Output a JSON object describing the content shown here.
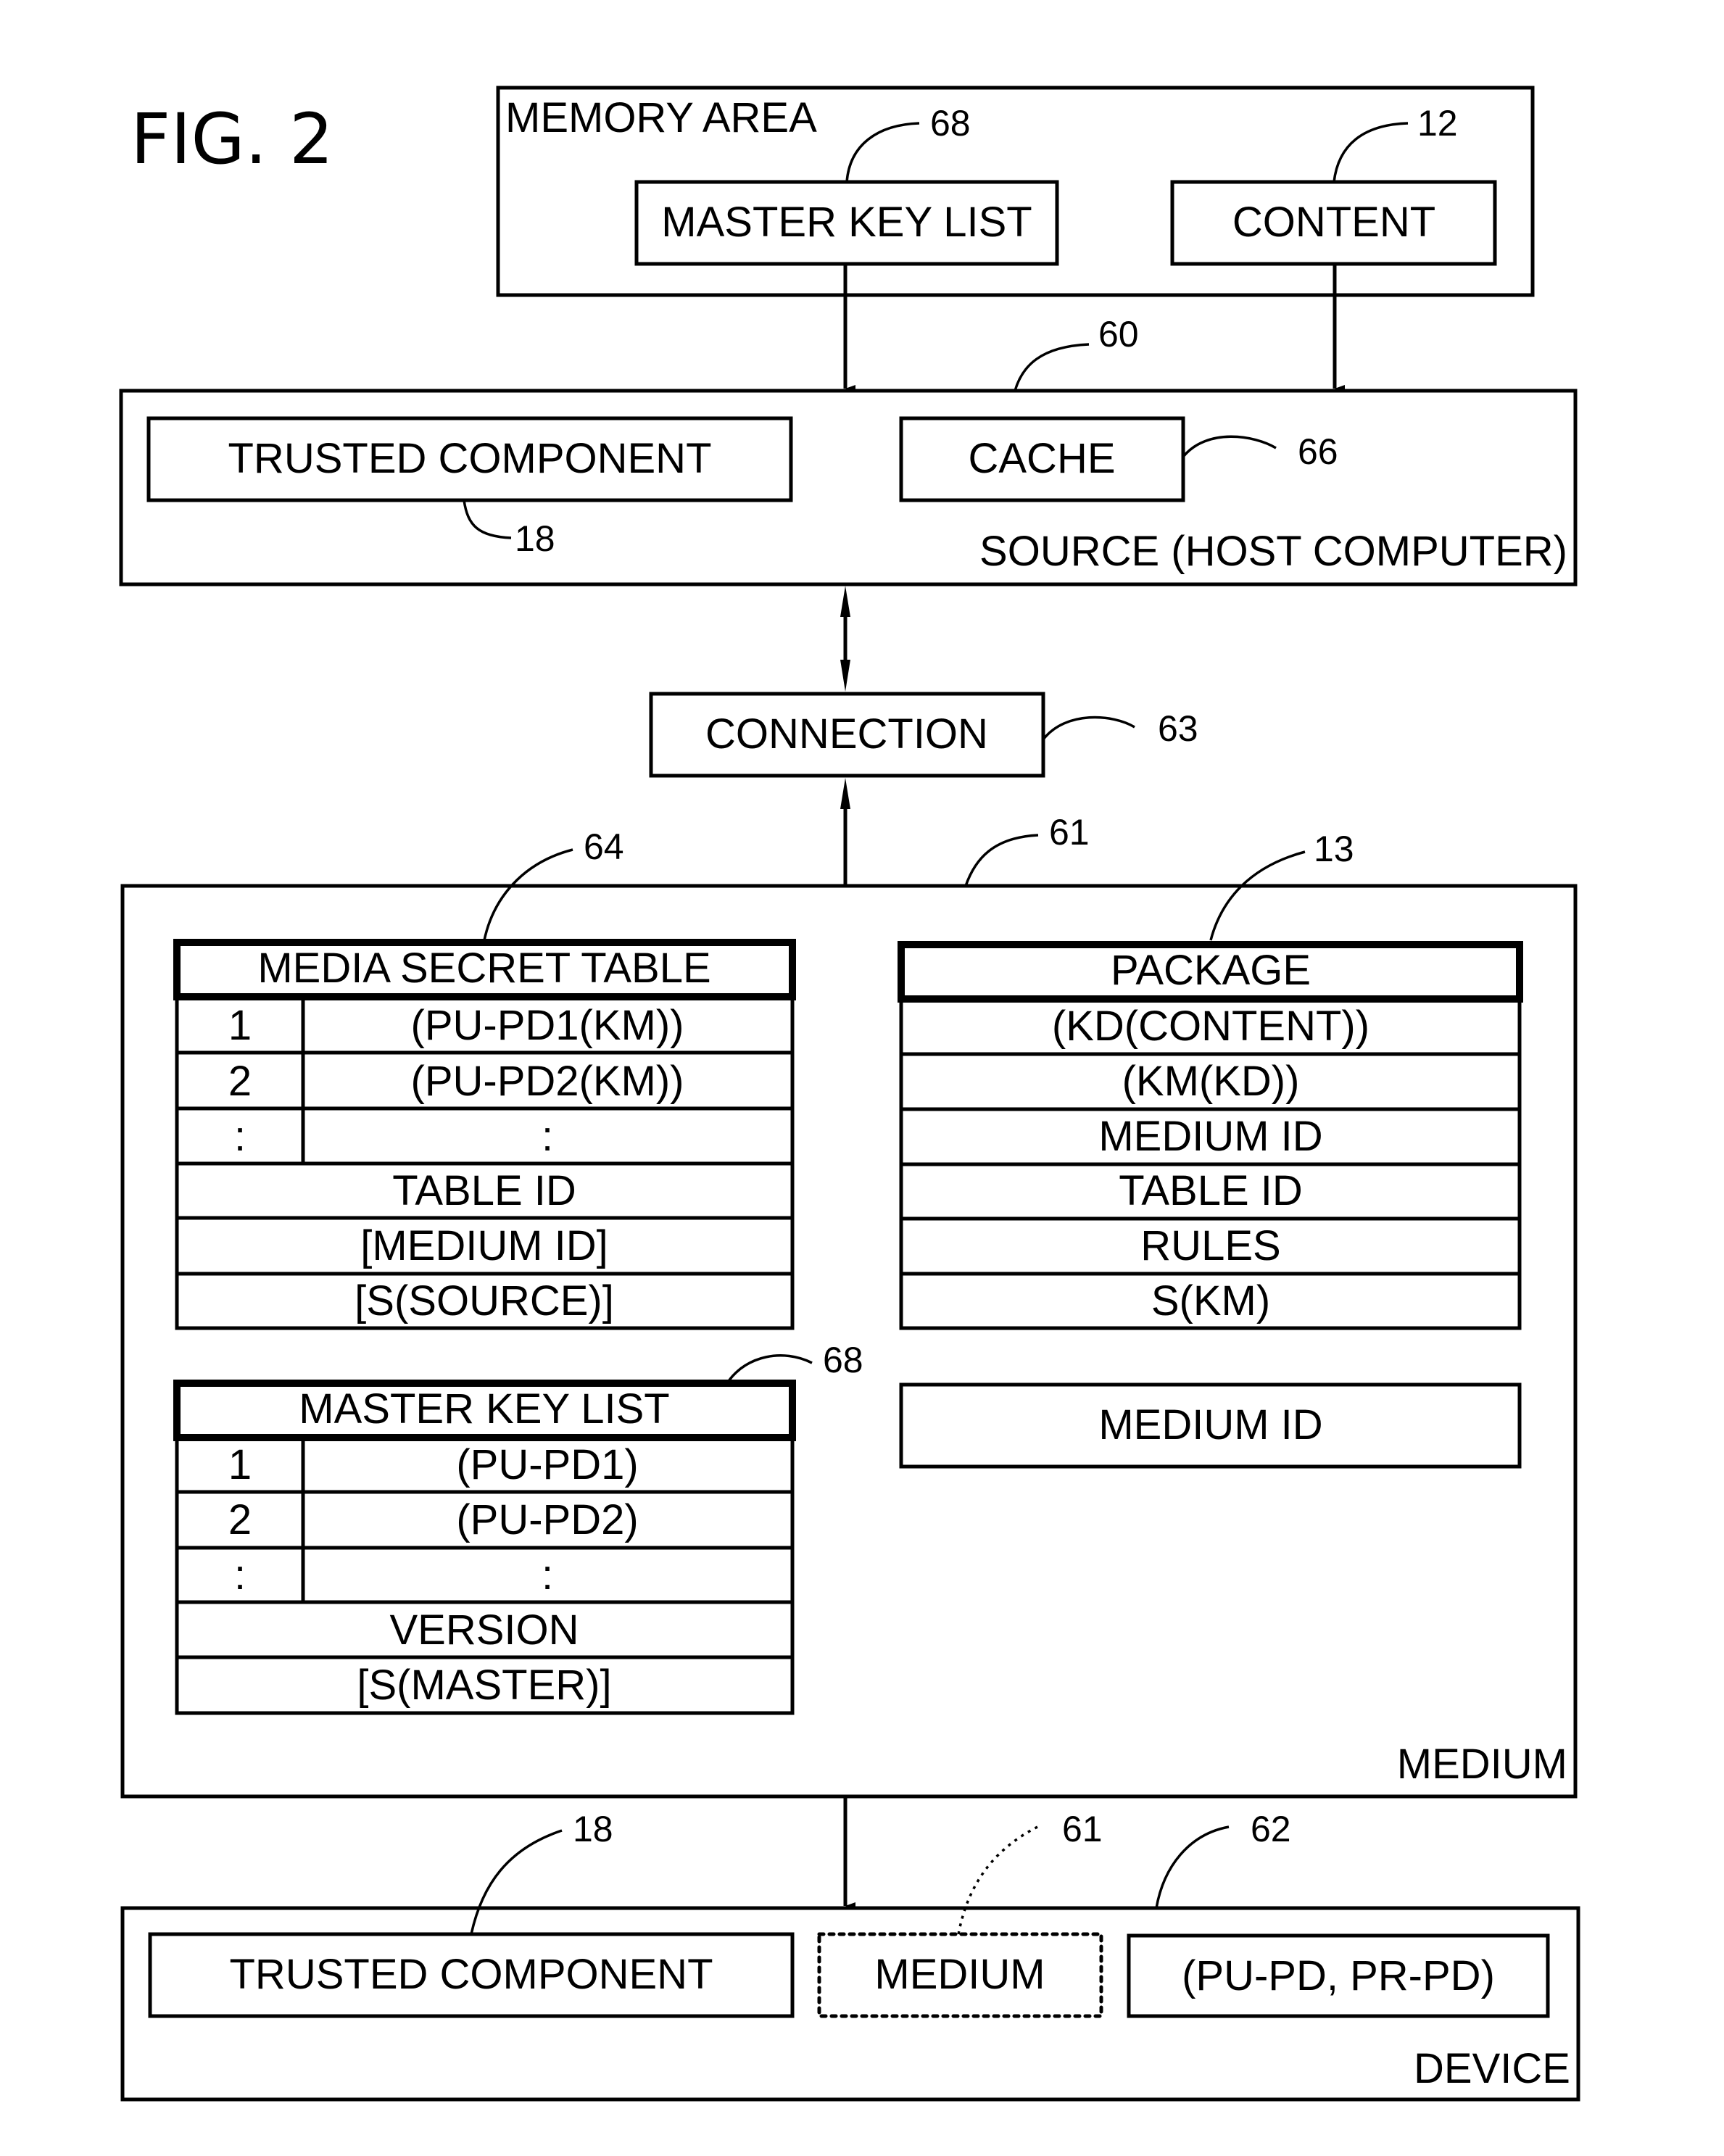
{
  "figure": {
    "title": "FIG. 2"
  },
  "colors": {
    "ink": "#000000",
    "paper": "#ffffff"
  },
  "memory_area": {
    "label": "MEMORY AREA",
    "master_key_list": {
      "label": "MASTER KEY LIST",
      "ref": "68"
    },
    "content": {
      "label": "CONTENT",
      "ref": "12"
    }
  },
  "source": {
    "label": "SOURCE (HOST COMPUTER)",
    "ref": "60",
    "trusted_component": {
      "label": "TRUSTED COMPONENT",
      "ref": "18"
    },
    "cache": {
      "label": "CACHE",
      "ref": "66"
    }
  },
  "connection": {
    "label": "CONNECTION",
    "ref": "63"
  },
  "medium": {
    "label": "MEDIUM",
    "ref": "61",
    "media_secret_table": {
      "title": "MEDIA SECRET TABLE",
      "ref": "64",
      "rows": [
        {
          "index": "1",
          "value": "(PU-PD1(KM))"
        },
        {
          "index": "2",
          "value": "(PU-PD2(KM))"
        },
        {
          "index": ":",
          "value": ":"
        }
      ],
      "footer_rows": [
        "TABLE ID",
        "[MEDIUM ID]",
        "[S(SOURCE)]"
      ]
    },
    "package": {
      "title": "PACKAGE",
      "ref": "13",
      "rows": [
        "(KD(CONTENT))",
        "(KM(KD))",
        "MEDIUM ID",
        "TABLE ID",
        "RULES",
        "S(KM)"
      ]
    },
    "medium_id": {
      "label": "MEDIUM ID"
    },
    "master_key_list": {
      "title": "MASTER KEY LIST",
      "ref": "68",
      "rows": [
        {
          "index": "1",
          "value": "(PU-PD1)"
        },
        {
          "index": "2",
          "value": "(PU-PD2)"
        },
        {
          "index": ":",
          "value": ":"
        }
      ],
      "footer_rows": [
        "VERSION",
        "[S(MASTER)]"
      ]
    }
  },
  "device": {
    "label": "DEVICE",
    "trusted_component": {
      "label": "TRUSTED COMPONENT",
      "ref": "18"
    },
    "medium": {
      "label": "MEDIUM",
      "ref": "61"
    },
    "keys": {
      "label": "(PU-PD, PR-PD)",
      "ref": "62"
    }
  }
}
